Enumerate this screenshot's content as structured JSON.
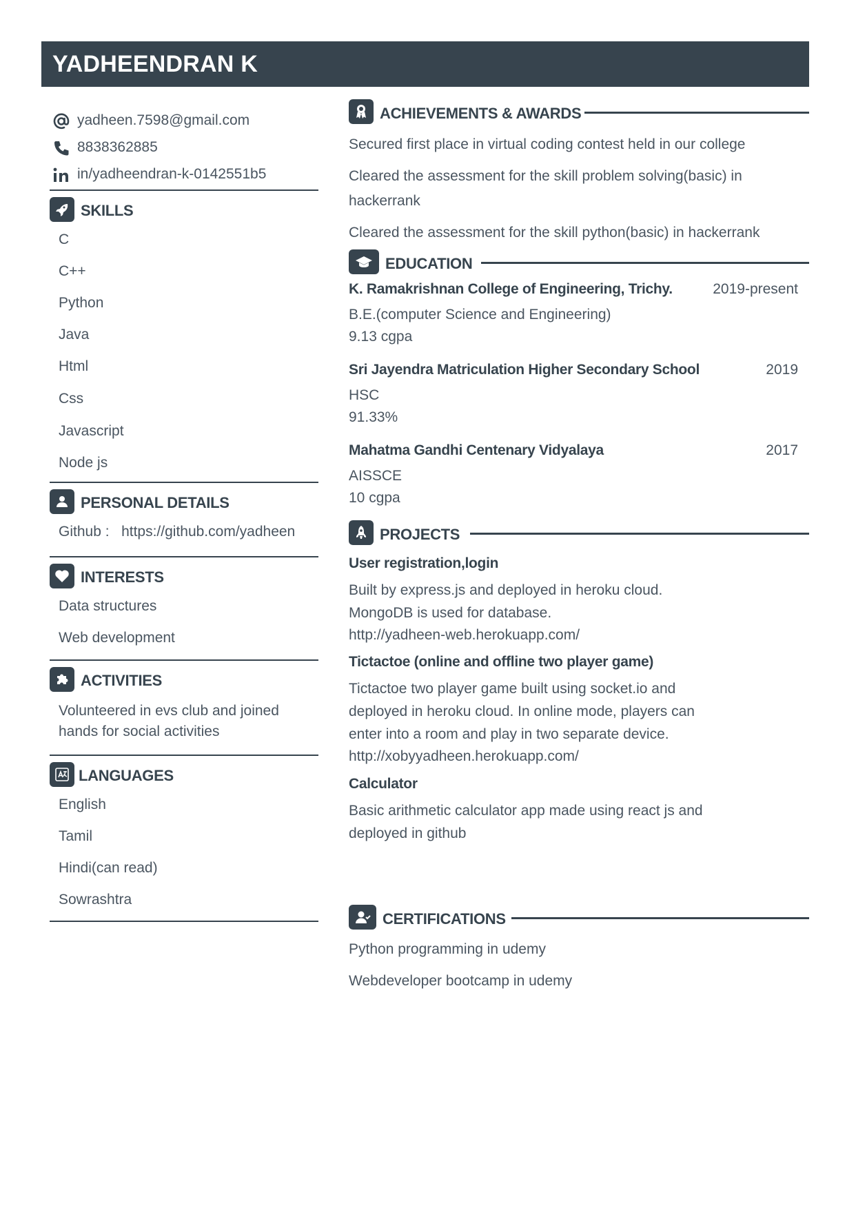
{
  "header": {
    "name": "YADHEENDRAN K"
  },
  "contact": {
    "email": "yadheen.7598@gmail.com",
    "phone": "8838362885",
    "linkedin": "in/yadheendran-k-0142551b5",
    "email_icon": "at-icon",
    "phone_icon": "phone-icon",
    "linkedin_icon": "linkedin-icon"
  },
  "skills": {
    "title": "SKILLS",
    "items": [
      "C",
      "C++",
      "Python",
      "Java",
      "Html",
      "Css",
      "Javascript",
      "Node js"
    ]
  },
  "personal": {
    "title": "PERSONAL DETAILS",
    "github_label": "Github :",
    "github_value": "https://github.com/yadheen"
  },
  "interests": {
    "title": "INTERESTS",
    "items": [
      "Data structures",
      "Web development"
    ]
  },
  "activities": {
    "title": "ACTIVITIES",
    "line1": "Volunteered in evs club and joined",
    "line2": "hands for social activities"
  },
  "languages": {
    "title": "LANGUAGES",
    "items": [
      "English",
      "Tamil",
      "Hindi(can read)",
      "Sowrashtra"
    ]
  },
  "achievements": {
    "title": "ACHIEVEMENTS & AWARDS",
    "item1": "Secured first place in virtual coding contest held in our college",
    "item2_line1": "Cleared the assessment for the skill problem solving(basic) in",
    "item2_line2": "hackerrank",
    "item3": "Cleared the assessment for the skill python(basic) in hackerrank"
  },
  "education": {
    "title": "EDUCATION",
    "entries": [
      {
        "school": "K. Ramakrishnan College of Engineering, Trichy.",
        "year": "2019-present",
        "degree": "B.E.(computer Science and Engineering)",
        "score": "9.13 cgpa"
      },
      {
        "school": "Sri Jayendra Matriculation Higher Secondary School",
        "year": "2019",
        "degree": "HSC",
        "score": "91.33%"
      },
      {
        "school": "Mahatma Gandhi Centenary Vidyalaya",
        "year": "2017",
        "degree": "AISSCE",
        "score": "10 cgpa"
      }
    ]
  },
  "projects": {
    "title": "PROJECTS",
    "p1": {
      "title": "User registration,login",
      "l1": "Built by express.js and deployed in heroku cloud.",
      "l2": "MongoDB is used for database.",
      "l3": "http://yadheen-web.herokuapp.com/"
    },
    "p2": {
      "title": "Tictactoe (online and offline two player game)",
      "l1": "Tictactoe two player game built using socket.io and",
      "l2": "deployed in heroku cloud.  In online mode, players can",
      "l3": "enter into a room and play in two separate device.",
      "l4": "http://xobyyadheen.herokuapp.com/"
    },
    "p3": {
      "title": "Calculator",
      "l1": "Basic arithmetic calculator app made using react js and",
      "l2": "deployed in github"
    }
  },
  "certifications": {
    "title": "CERTIFICATIONS",
    "items": [
      "Python programming in udemy",
      "Webdeveloper bootcamp in udemy"
    ]
  },
  "colors": {
    "accent": "#37444e",
    "text": "#4a5560"
  }
}
